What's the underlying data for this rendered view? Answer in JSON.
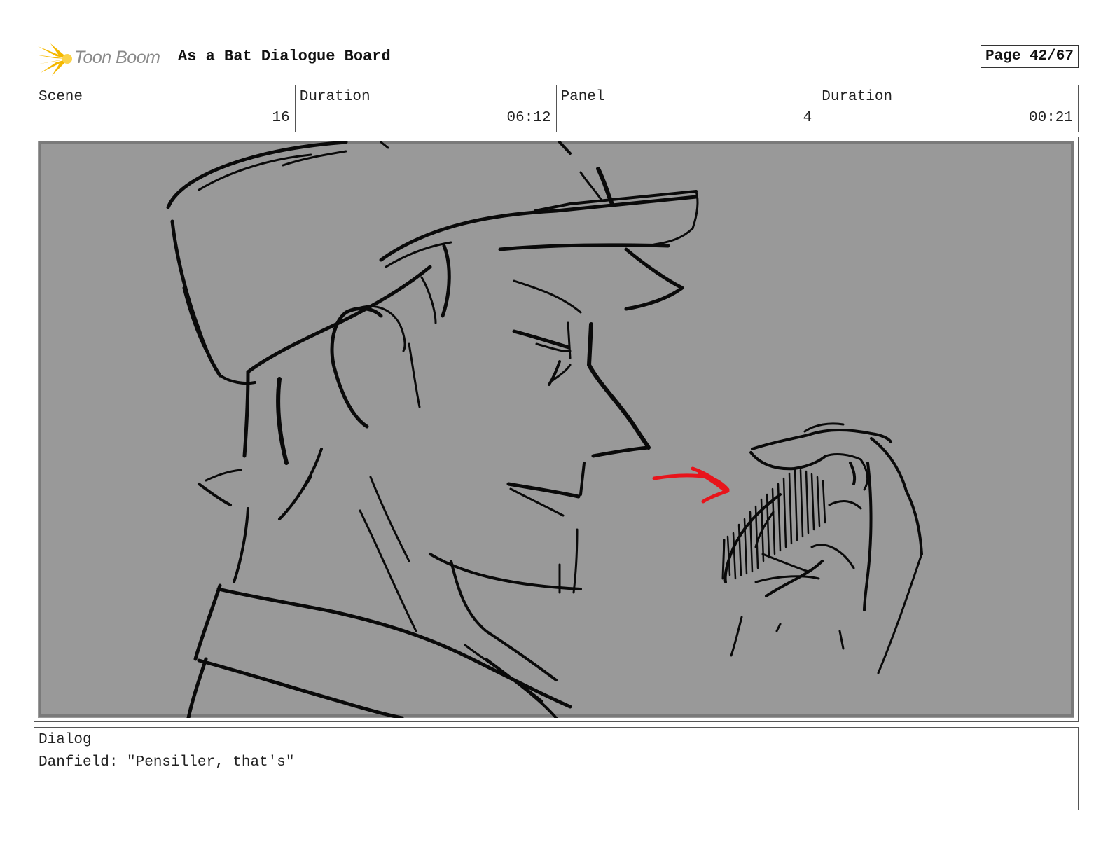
{
  "header": {
    "logo_text": "Toon Boom",
    "board_title": "As a Bat Dialogue Board",
    "page_label": "Page 42/67"
  },
  "info": {
    "scene_label": "Scene",
    "scene_value": "16",
    "scene_duration_label": "Duration",
    "scene_duration_value": "06:12",
    "panel_label": "Panel",
    "panel_value": "4",
    "panel_duration_label": "Duration",
    "panel_duration_value": "00:21"
  },
  "panel": {
    "background_color": "#999999",
    "arrow_color": "#e8141b"
  },
  "dialog": {
    "label": "Dialog",
    "text": "Danfield: \"Pensiller, that's\""
  }
}
